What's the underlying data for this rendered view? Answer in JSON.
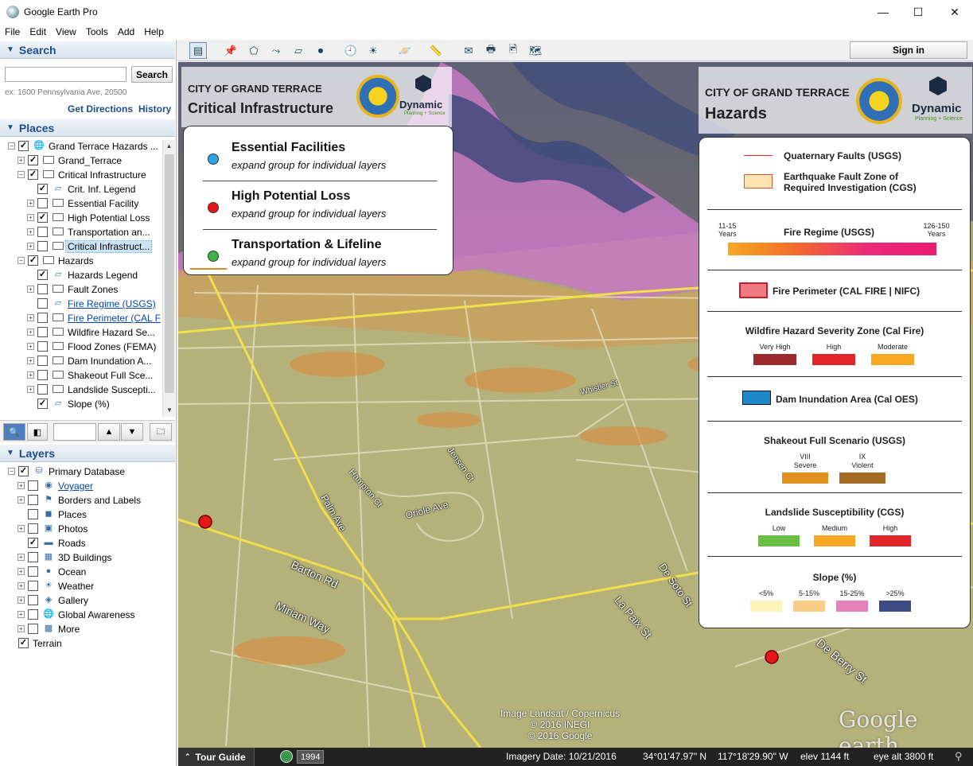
{
  "window": {
    "title": "Google Earth Pro",
    "minimize": "—",
    "maximize": "☐",
    "close": "✕"
  },
  "menu": [
    "File",
    "Edit",
    "View",
    "Tools",
    "Add",
    "Help"
  ],
  "search": {
    "header": "Search",
    "placeholder": "",
    "button": "Search",
    "hint": "ex: 1600 Pennsylvania Ave, 20500",
    "get_directions": "Get Directions",
    "history": "History"
  },
  "places": {
    "header": "Places",
    "items": [
      {
        "label": "Grand Terrace Hazards ...",
        "depth": 0,
        "expand": "−",
        "checked": true,
        "icon": "globe-icon",
        "link": false
      },
      {
        "label": "Grand_Terrace",
        "depth": 1,
        "expand": "+",
        "checked": true,
        "icon": "folder-icon",
        "link": false
      },
      {
        "label": "Critical Infrastructure",
        "depth": 1,
        "expand": "−",
        "checked": true,
        "icon": "open-folder-icon",
        "link": false
      },
      {
        "label": "Crit. Inf. Legend",
        "depth": 2,
        "expand": "",
        "checked": true,
        "icon": "overlay-icon",
        "link": false
      },
      {
        "label": "Essential Facility",
        "depth": 2,
        "expand": "+",
        "checked": false,
        "icon": "folder-icon",
        "link": false
      },
      {
        "label": "High Potential Loss",
        "depth": 2,
        "expand": "+",
        "checked": true,
        "icon": "folder-icon",
        "link": false
      },
      {
        "label": "Transportation an...",
        "depth": 2,
        "expand": "+",
        "checked": false,
        "icon": "folder-icon",
        "link": false
      },
      {
        "label": "Critical Infrastruct...",
        "depth": 2,
        "expand": "+",
        "checked": false,
        "icon": "folder-icon",
        "link": false,
        "selected": true
      },
      {
        "label": "Hazards",
        "depth": 1,
        "expand": "−",
        "checked": true,
        "icon": "open-folder-icon",
        "link": false
      },
      {
        "label": "Hazards Legend",
        "depth": 2,
        "expand": "",
        "checked": true,
        "icon": "overlay-icon",
        "link": false
      },
      {
        "label": "Fault Zones",
        "depth": 2,
        "expand": "+",
        "checked": false,
        "icon": "folder-icon",
        "link": false
      },
      {
        "label": "Fire Regime (USGS)",
        "depth": 2,
        "expand": "",
        "checked": false,
        "icon": "overlay-icon",
        "link": true
      },
      {
        "label": "Fire Perimeter (CAL F",
        "depth": 2,
        "expand": "+",
        "checked": false,
        "icon": "folder-icon",
        "link": true
      },
      {
        "label": "Wildfire Hazard Se...",
        "depth": 2,
        "expand": "+",
        "checked": false,
        "icon": "folder-icon",
        "link": false
      },
      {
        "label": "Flood Zones (FEMA)",
        "depth": 2,
        "expand": "+",
        "checked": false,
        "icon": "folder-icon",
        "link": false
      },
      {
        "label": "Dam Inundation A...",
        "depth": 2,
        "expand": "+",
        "checked": false,
        "icon": "folder-icon",
        "link": false
      },
      {
        "label": "Shakeout Full Sce...",
        "depth": 2,
        "expand": "+",
        "checked": false,
        "icon": "folder-icon",
        "link": false
      },
      {
        "label": "Landslide Suscepti...",
        "depth": 2,
        "expand": "+",
        "checked": false,
        "icon": "folder-icon",
        "link": false
      },
      {
        "label": "Slope (%)",
        "depth": 2,
        "expand": "",
        "checked": true,
        "icon": "overlay-icon",
        "link": false
      }
    ]
  },
  "layers": {
    "header": "Layers",
    "items": [
      {
        "label": "Primary Database",
        "depth": 0,
        "expand": "−",
        "checked": true,
        "icon": "database-icon",
        "link": false
      },
      {
        "label": "Voyager",
        "depth": 1,
        "expand": "+",
        "checked": false,
        "icon": "voyager-icon",
        "link": true
      },
      {
        "label": "Borders and Labels",
        "depth": 1,
        "expand": "+",
        "checked": false,
        "icon": "flag-icon",
        "link": false
      },
      {
        "label": "Places",
        "depth": 1,
        "expand": "",
        "checked": false,
        "icon": "places-icon",
        "link": false
      },
      {
        "label": "Photos",
        "depth": 1,
        "expand": "+",
        "checked": false,
        "icon": "photo-icon",
        "link": false
      },
      {
        "label": "Roads",
        "depth": 1,
        "expand": "",
        "checked": true,
        "icon": "road-icon",
        "link": false
      },
      {
        "label": "3D Buildings",
        "depth": 1,
        "expand": "+",
        "checked": false,
        "icon": "building-icon",
        "link": false
      },
      {
        "label": "Ocean",
        "depth": 1,
        "expand": "+",
        "checked": false,
        "icon": "ocean-icon",
        "link": false
      },
      {
        "label": "Weather",
        "depth": 1,
        "expand": "+",
        "checked": false,
        "icon": "weather-icon",
        "link": false
      },
      {
        "label": "Gallery",
        "depth": 1,
        "expand": "+",
        "checked": false,
        "icon": "gallery-icon",
        "link": false
      },
      {
        "label": "Global Awareness",
        "depth": 1,
        "expand": "+",
        "checked": false,
        "icon": "globe-icon",
        "link": false
      },
      {
        "label": "More",
        "depth": 1,
        "expand": "+",
        "checked": false,
        "icon": "more-icon",
        "link": false
      },
      {
        "label": "Terrain",
        "depth": 0,
        "expand": "",
        "checked": true,
        "icon": "",
        "link": false
      }
    ]
  },
  "toolbar": {
    "sign_in": "Sign in"
  },
  "crit_panel": {
    "city": "CITY OF GRAND TERRACE",
    "title": "Critical Infrastructure",
    "logo_word": "Dynamic",
    "logo_sub": "Planning + Science",
    "items": [
      {
        "title": "Essential Facilities",
        "sub": "expand group for individual layers",
        "color": "#29a8e0",
        "marker": "dot"
      },
      {
        "title": "High Potential Loss",
        "sub": "expand group for individual layers",
        "color": "#e8161b",
        "marker": "dot"
      },
      {
        "title": "Transportation & Lifeline",
        "sub": "expand group for individual layers",
        "color": "#3cb54a",
        "marker": "dot-line",
        "line_color": "#d98a2b"
      }
    ]
  },
  "hazards_panel": {
    "city": "CITY OF GRAND TERRACE",
    "title": "Hazards",
    "logo_word": "Dynamic",
    "logo_sub": "Planning + Science",
    "faults": "Quaternary Faults (USGS)",
    "fault_zone": "Earthquake Fault Zone of Required Investigation (CGS)",
    "fire_regime": {
      "title": "Fire Regime (USGS)",
      "left": "11-15 Years",
      "right": "126-150 Years"
    },
    "fire_perimeter": "Fire Perimeter (CAL FIRE | NIFC)",
    "wildfire": {
      "title": "Wildfire Hazard Severity Zone (Cal Fire)",
      "classes": [
        {
          "label": "Very High",
          "color": "#9b2a2d"
        },
        {
          "label": "High",
          "color": "#e2242b"
        },
        {
          "label": "Moderate",
          "color": "#f7a823"
        }
      ]
    },
    "dam": "Dam Inundation Area (Cal OES)",
    "shakeout": {
      "title": "Shakeout Full Scenario (USGS)",
      "classes": [
        {
          "label": "VIII",
          "sub": "Severe",
          "color": "#e0901f"
        },
        {
          "label": "IX",
          "sub": "Violent",
          "color": "#a56d24"
        }
      ]
    },
    "landslide": {
      "title": "Landslide Susceptibility (CGS)",
      "classes": [
        {
          "label": "Low",
          "color": "#6abd45"
        },
        {
          "label": "Medium",
          "color": "#f7a823"
        },
        {
          "label": "High",
          "color": "#e2242b"
        }
      ]
    },
    "slope": {
      "title": "Slope (%)",
      "classes": [
        {
          "label": "<5%",
          "color": "#fbf4b9"
        },
        {
          "label": "5-15%",
          "color": "#f9cd85"
        },
        {
          "label": "15-25%",
          "color": "#e580b9"
        },
        {
          "label": ">25%",
          "color": "#3e4a85"
        }
      ]
    }
  },
  "map_labels": [
    "Whistler St",
    "Jensen Ct",
    "Hampton Ct",
    "Palm Ave",
    "Oriole Ave",
    "Barton Rd",
    "Miriam Way",
    "De Soto St",
    "La Paix St",
    "De Berry St"
  ],
  "attribution": [
    "Image Landsat / Copernicus",
    "© 2016 INEGI",
    "© 2016 Google"
  ],
  "watermark": "Google earth",
  "status": {
    "tour_guide": "Tour Guide",
    "year": "1994",
    "imagery_date": "Imagery Date: 10/21/2016",
    "lat": "34°01'47.97\" N",
    "lon": "117°18'29.90\" W",
    "elev": "elev  1144 ft",
    "eye_alt": "eye alt  3800 ft"
  }
}
